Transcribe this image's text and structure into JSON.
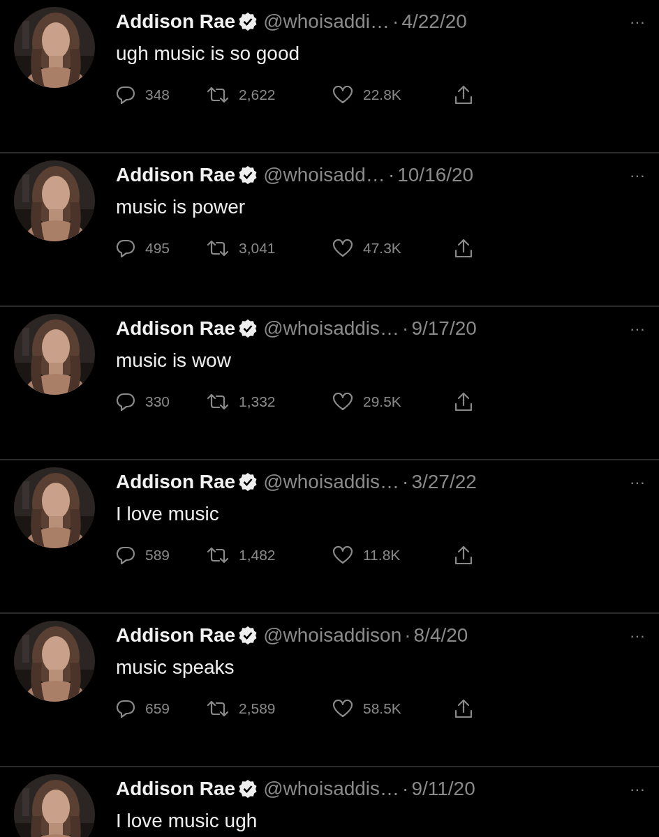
{
  "tweets": [
    {
      "name": "Addison Rae",
      "verified": true,
      "handle": "@whoisaddi…",
      "separator": "·",
      "date": "4/22/20",
      "more": "···",
      "text": "ugh music is so good",
      "replies": "348",
      "retweets": "2,622",
      "likes": "22.8K"
    },
    {
      "name": "Addison Rae",
      "verified": true,
      "handle": "@whoisadd…",
      "separator": "·",
      "date": "10/16/20",
      "more": "···",
      "text": "music is power",
      "replies": "495",
      "retweets": "3,041",
      "likes": "47.3K"
    },
    {
      "name": "Addison Rae",
      "verified": true,
      "handle": "@whoisaddis…",
      "separator": "·",
      "date": "9/17/20",
      "more": "···",
      "text": "music is wow",
      "replies": "330",
      "retweets": "1,332",
      "likes": "29.5K"
    },
    {
      "name": "Addison Rae",
      "verified": true,
      "handle": "@whoisaddis…",
      "separator": "·",
      "date": "3/27/22",
      "more": "···",
      "text": "I love music",
      "replies": "589",
      "retweets": "1,482",
      "likes": "11.8K"
    },
    {
      "name": "Addison Rae",
      "verified": true,
      "handle": "@whoisaddison",
      "separator": "·",
      "date": "8/4/20",
      "more": "···",
      "text": "music speaks",
      "replies": "659",
      "retweets": "2,589",
      "likes": "58.5K"
    },
    {
      "name": "Addison Rae",
      "verified": true,
      "handle": "@whoisaddis…",
      "separator": "·",
      "date": "9/11/20",
      "more": "···",
      "text": "I love music ugh"
    }
  ]
}
